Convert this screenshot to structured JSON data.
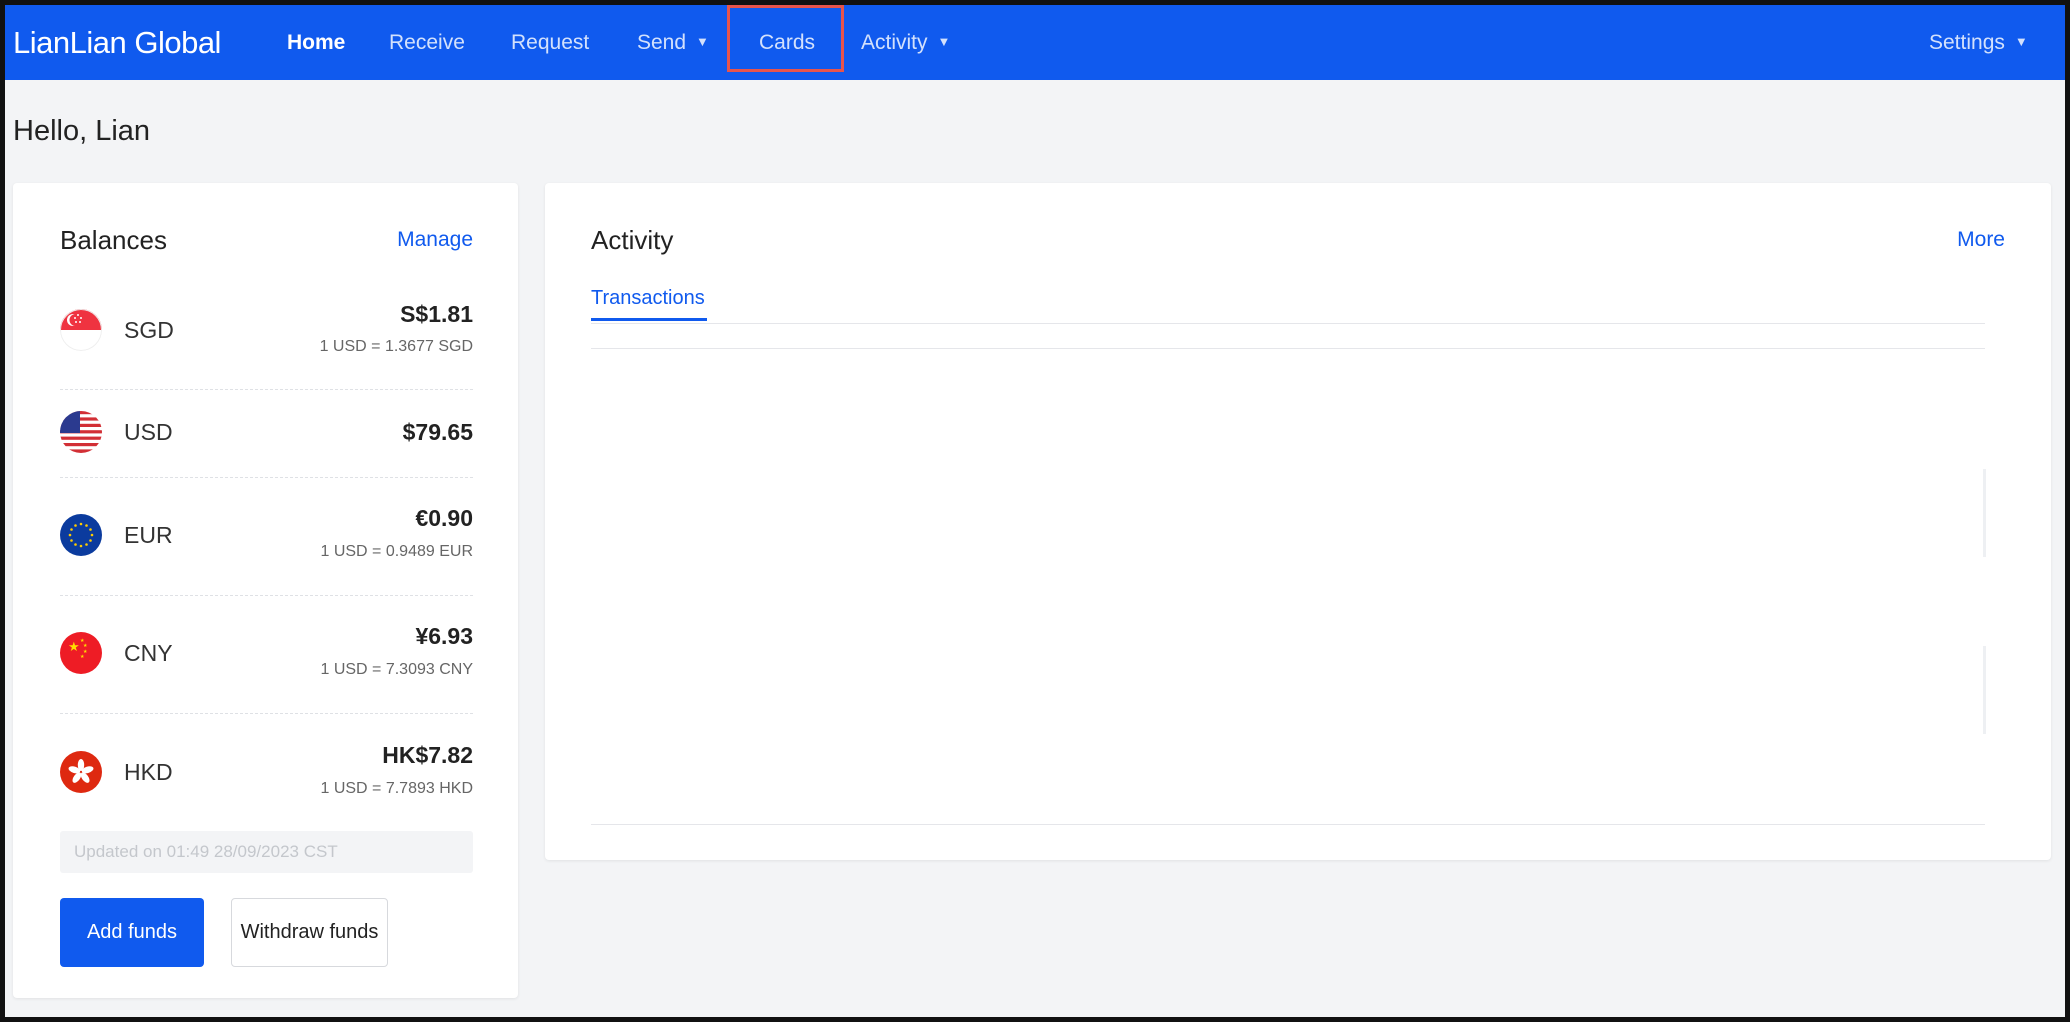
{
  "nav": {
    "logo": "LianLian Global",
    "items": [
      {
        "label": "Home",
        "active": true
      },
      {
        "label": "Receive"
      },
      {
        "label": "Request"
      },
      {
        "label": "Send",
        "dropdown": true
      },
      {
        "label": "Cards",
        "highlighted": true
      },
      {
        "label": "Activity",
        "dropdown": true
      }
    ],
    "settings_label": "Settings"
  },
  "greeting": "Hello, Lian",
  "balances": {
    "title": "Balances",
    "manage_label": "Manage",
    "items": [
      {
        "code": "SGD",
        "amount": "S$1.81",
        "rate": "1 USD = 1.3677 SGD",
        "flag_icon": "singapore-flag-icon"
      },
      {
        "code": "USD",
        "amount": "$79.65",
        "rate": "",
        "flag_icon": "us-flag-icon"
      },
      {
        "code": "EUR",
        "amount": "€0.90",
        "rate": "1 USD = 0.9489 EUR",
        "flag_icon": "eu-flag-icon"
      },
      {
        "code": "CNY",
        "amount": "¥6.93",
        "rate": "1 USD = 7.3093 CNY",
        "flag_icon": "china-flag-icon"
      },
      {
        "code": "HKD",
        "amount": "HK$7.82",
        "rate": "1 USD = 7.7893 HKD",
        "flag_icon": "hong-kong-flag-icon"
      }
    ],
    "updated_text": "Updated on 01:49 28/09/2023 CST",
    "add_funds_label": "Add funds",
    "withdraw_funds_label": "Withdraw funds"
  },
  "activity": {
    "title": "Activity",
    "more_label": "More",
    "tabs": [
      {
        "label": "Transactions",
        "active": true
      }
    ]
  },
  "colors": {
    "brand": "#105aee",
    "highlight_box": "#e7544c"
  }
}
